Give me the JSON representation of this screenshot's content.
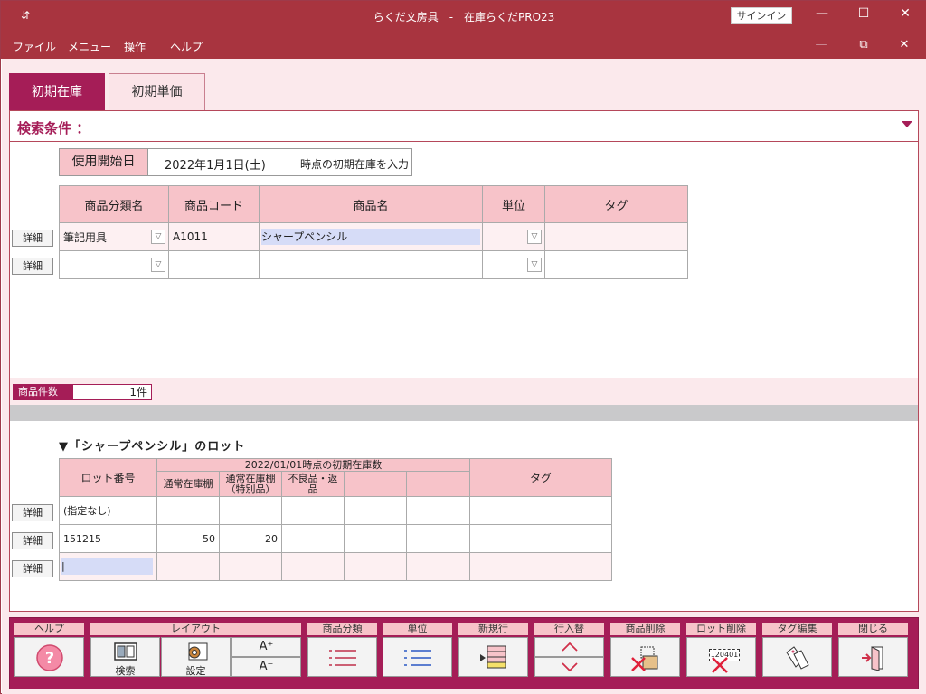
{
  "titlebar": {
    "menu_glyph": "⇵",
    "title": "らくだ文房具　-　在庫らくだPRO23",
    "signin_label": "サインイン",
    "minimize_glyph": "—",
    "maximize_glyph": "☐",
    "close_glyph": "✕"
  },
  "menubar": {
    "items": [
      "ファイル",
      "メニュー",
      "操作",
      "ヘルプ"
    ],
    "mdi_min": "—",
    "mdi_restore": "⧉",
    "mdi_close": "✕"
  },
  "tabs": [
    {
      "label": "初期在庫",
      "active": true
    },
    {
      "label": "初期単価",
      "active": false
    }
  ],
  "search": {
    "label": "検索条件 ："
  },
  "start_date": {
    "label": "使用開始日",
    "value": "2022年1月1日(土)",
    "note": "時点の初期在庫を入力"
  },
  "product_table": {
    "headers": [
      "商品分類名",
      "商品コード",
      "商品名",
      "単位",
      "タグ"
    ],
    "rows": [
      {
        "detail": "詳細",
        "category": "筆記用具",
        "code": "A1011",
        "name": "シャープペンシル",
        "unit": "",
        "tag": ""
      },
      {
        "detail": "詳細",
        "category": "",
        "code": "",
        "name": "",
        "unit": "",
        "tag": ""
      }
    ]
  },
  "product_count": {
    "label": "商品件数",
    "value": "1件"
  },
  "lot_section": {
    "title": "▼「シャープペンシル」のロット",
    "headers": {
      "lot_no": "ロット番号",
      "group": "2022/01/01時点の初期在庫数",
      "normal": "通常在庫棚",
      "special": "通常在庫棚\n（特別品）",
      "defect": "不良品・返\n品",
      "blank1": "",
      "blank2": "",
      "tag": "タグ"
    },
    "rows": [
      {
        "detail": "詳細",
        "lot": "(指定なし)",
        "normal": "",
        "special": "",
        "defect": "",
        "c4": "",
        "c5": "",
        "tag": ""
      },
      {
        "detail": "詳細",
        "lot": "151215",
        "normal": "50",
        "special": "20",
        "defect": "",
        "c4": "",
        "c5": "",
        "tag": ""
      },
      {
        "detail": "詳細",
        "lot": "|",
        "normal": "",
        "special": "",
        "defect": "",
        "c4": "",
        "c5": "",
        "tag": ""
      }
    ]
  },
  "toolbar": {
    "help": "ヘルプ",
    "layout": "レイアウト",
    "layout_search": "検索",
    "layout_settings": "設定",
    "font_up": "A⁺",
    "font_down": "A⁻",
    "category": "商品分類",
    "unit": "単位",
    "new_row": "新規行",
    "row_swap": "行入替",
    "delete_product": "商品削除",
    "delete_lot": "ロット削除",
    "lot_label_icon": "120401",
    "tag_edit": "タグ編集",
    "close": "閉じる"
  },
  "colors": {
    "titlebar": "#a8343f",
    "accent": "#a51d57",
    "header_pink": "#f7c3c9",
    "background_pink": "#fbe9ec"
  }
}
